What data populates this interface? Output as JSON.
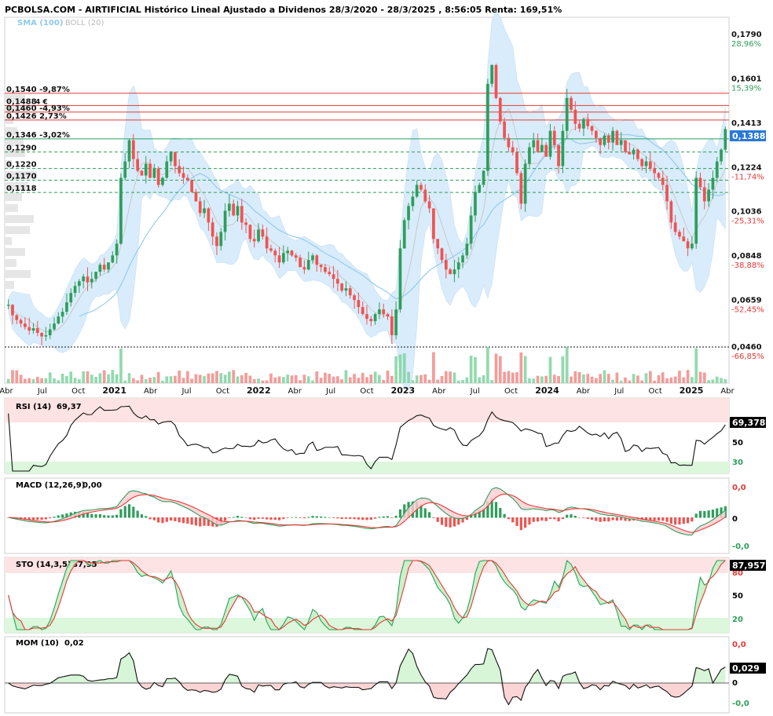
{
  "header": {
    "title": "PCBOLSA.COM - AIRTIFICIAL Histórico Lineal Ajustado a Dividenos 28/3/2020 - 28/3/2025 , 8:56:05 Renta: 169,51%",
    "legend_sma": "SMA (100)",
    "legend_boll": "BOLL (20)"
  },
  "colors": {
    "up": "#2e9e5b",
    "down": "#ef5350",
    "band_fill": "#d9ecfb",
    "sma": "#8ec9ef",
    "red_level": "#e53935",
    "green_level": "#2e9e5b",
    "price_badge": "#2979d8",
    "rsi_band_top": "#fde3e3",
    "rsi_band_bottom": "#dcf7dc"
  },
  "chart_data": [
    {
      "type": "candlestick",
      "name": "price",
      "x_tick_labels": [
        "Abr",
        "Jul",
        "Oct",
        "2021",
        "Abr",
        "Jul",
        "Oct",
        "2022",
        "Abr",
        "Jul",
        "Oct",
        "2023",
        "Abr",
        "Jul",
        "Oct",
        "2024",
        "Abr",
        "Jul",
        "Oct",
        "2025",
        "Abr"
      ],
      "x_ticks_bold": [
        "2021",
        "2022",
        "2023",
        "2024",
        "2025"
      ],
      "y_tick_labels": [
        {
          "value": "0,1790",
          "pct": "28,96%",
          "pct_color": "#2e9e5b"
        },
        {
          "value": "0,1601",
          "pct": "15,39%",
          "pct_color": "#2e9e5b"
        },
        {
          "value": "0,1413",
          "pct": "",
          "pct_color": "#2e9e5b"
        },
        {
          "value": "0,1224",
          "pct": "-11,74%",
          "pct_color": "#e53935"
        },
        {
          "value": "0,1036",
          "pct": "-25,31%",
          "pct_color": "#e53935"
        },
        {
          "value": "0,0848",
          "pct": "-38,88%",
          "pct_color": "#e53935"
        },
        {
          "value": "0,0659",
          "pct": "-52,45%",
          "pct_color": "#e53935"
        },
        {
          "value": "0,0460",
          "pct": "-66,85%",
          "pct_color": "#e53935"
        }
      ],
      "ylim": [
        0.046,
        0.179
      ],
      "last_price": "0,1388",
      "levels": [
        {
          "value": "0,1540",
          "label": "0,1540  -9,87%",
          "color": "#e53935",
          "style": "solid"
        },
        {
          "value": "0,1488",
          "label": "0,1488",
          "tag": "4 €",
          "color": "#e53935",
          "style": "solid"
        },
        {
          "value": "0,1460",
          "label": "0,1460  -4,93%",
          "color": "#e53935",
          "style": "solid"
        },
        {
          "value": "0,1426",
          "label": "0,1426  2,73%",
          "color": "#e53935",
          "style": "solid"
        },
        {
          "value": "0,1346",
          "label": "0,1346  -3,02%",
          "color": "#2e9e5b",
          "style": "solid"
        },
        {
          "value": "0,1290",
          "label": "0,1290",
          "color": "#2e9e5b",
          "style": "dashed"
        },
        {
          "value": "0,1220",
          "label": "0,1220",
          "color": "#2e9e5b",
          "style": "dashed"
        },
        {
          "value": "0,1170",
          "label": "0,1170",
          "color": "#2e9e5b",
          "style": "dashed"
        },
        {
          "value": "0,1118",
          "label": "0,1118",
          "color": "#2e9e5b",
          "style": "dashed"
        }
      ],
      "close_series": [
        0.064,
        0.0595,
        0.0575,
        0.056,
        0.0545,
        0.053,
        0.054,
        0.052,
        0.0505,
        0.051,
        0.0535,
        0.056,
        0.059,
        0.061,
        0.065,
        0.069,
        0.072,
        0.074,
        0.076,
        0.0735,
        0.075,
        0.078,
        0.081,
        0.079,
        0.082,
        0.085,
        0.09,
        0.118,
        0.125,
        0.134,
        0.126,
        0.121,
        0.119,
        0.124,
        0.118,
        0.122,
        0.115,
        0.118,
        0.125,
        0.129,
        0.123,
        0.12,
        0.118,
        0.117,
        0.112,
        0.108,
        0.103,
        0.105,
        0.099,
        0.093,
        0.089,
        0.095,
        0.104,
        0.107,
        0.102,
        0.106,
        0.099,
        0.098,
        0.092,
        0.091,
        0.096,
        0.093,
        0.088,
        0.087,
        0.085,
        0.082,
        0.086,
        0.087,
        0.085,
        0.084,
        0.08,
        0.079,
        0.083,
        0.085,
        0.081,
        0.08,
        0.078,
        0.077,
        0.075,
        0.073,
        0.07,
        0.071,
        0.068,
        0.066,
        0.063,
        0.06,
        0.058,
        0.057,
        0.06,
        0.062,
        0.06,
        0.059,
        0.051,
        0.062,
        0.088,
        0.1,
        0.106,
        0.11,
        0.115,
        0.113,
        0.108,
        0.105,
        0.092,
        0.088,
        0.083,
        0.079,
        0.077,
        0.079,
        0.082,
        0.085,
        0.09,
        0.102,
        0.112,
        0.115,
        0.121,
        0.158,
        0.166,
        0.152,
        0.142,
        0.135,
        0.131,
        0.129,
        0.12,
        0.107,
        0.124,
        0.131,
        0.134,
        0.129,
        0.132,
        0.127,
        0.138,
        0.132,
        0.123,
        0.138,
        0.152,
        0.147,
        0.141,
        0.139,
        0.143,
        0.14,
        0.138,
        0.135,
        0.132,
        0.136,
        0.133,
        0.138,
        0.132,
        0.134,
        0.129,
        0.128,
        0.13,
        0.126,
        0.123,
        0.125,
        0.122,
        0.12,
        0.118,
        0.115,
        0.108,
        0.099,
        0.095,
        0.093,
        0.091,
        0.088,
        0.09,
        0.118,
        0.114,
        0.108,
        0.113,
        0.118,
        0.125,
        0.13,
        0.1388
      ]
    },
    {
      "type": "line",
      "name": "RSI",
      "title": "RSI (14)",
      "title_value": "69,37",
      "last_value": "69,378",
      "y_tick_labels": [
        "50",
        "30"
      ],
      "ylim": [
        0,
        100
      ]
    },
    {
      "type": "line",
      "name": "MACD",
      "title": "MACD (12,26,9)",
      "title_value": "0,00",
      "y_tick_labels": [
        {
          "label": "0,0",
          "color": "#e53935"
        },
        {
          "label": "0",
          "color": "#111111"
        },
        {
          "label": "-0,0",
          "color": "#2e9e5b"
        }
      ]
    },
    {
      "type": "line",
      "name": "STO",
      "title": "STO (14,3,5)",
      "title_value": "87,95",
      "last_value": "87,957",
      "y_tick_labels": [
        "80",
        "50",
        "20"
      ],
      "ylim": [
        0,
        100
      ]
    },
    {
      "type": "line",
      "name": "MOM",
      "title": "MOM (10)",
      "title_value": "0,02",
      "last_value": "0,029",
      "y_tick_labels": [
        {
          "label": "0,0",
          "color": "#e53935"
        },
        {
          "label": "0",
          "color": "#111111"
        },
        {
          "label": "-0,0",
          "color": "#2e9e5b"
        }
      ]
    }
  ]
}
